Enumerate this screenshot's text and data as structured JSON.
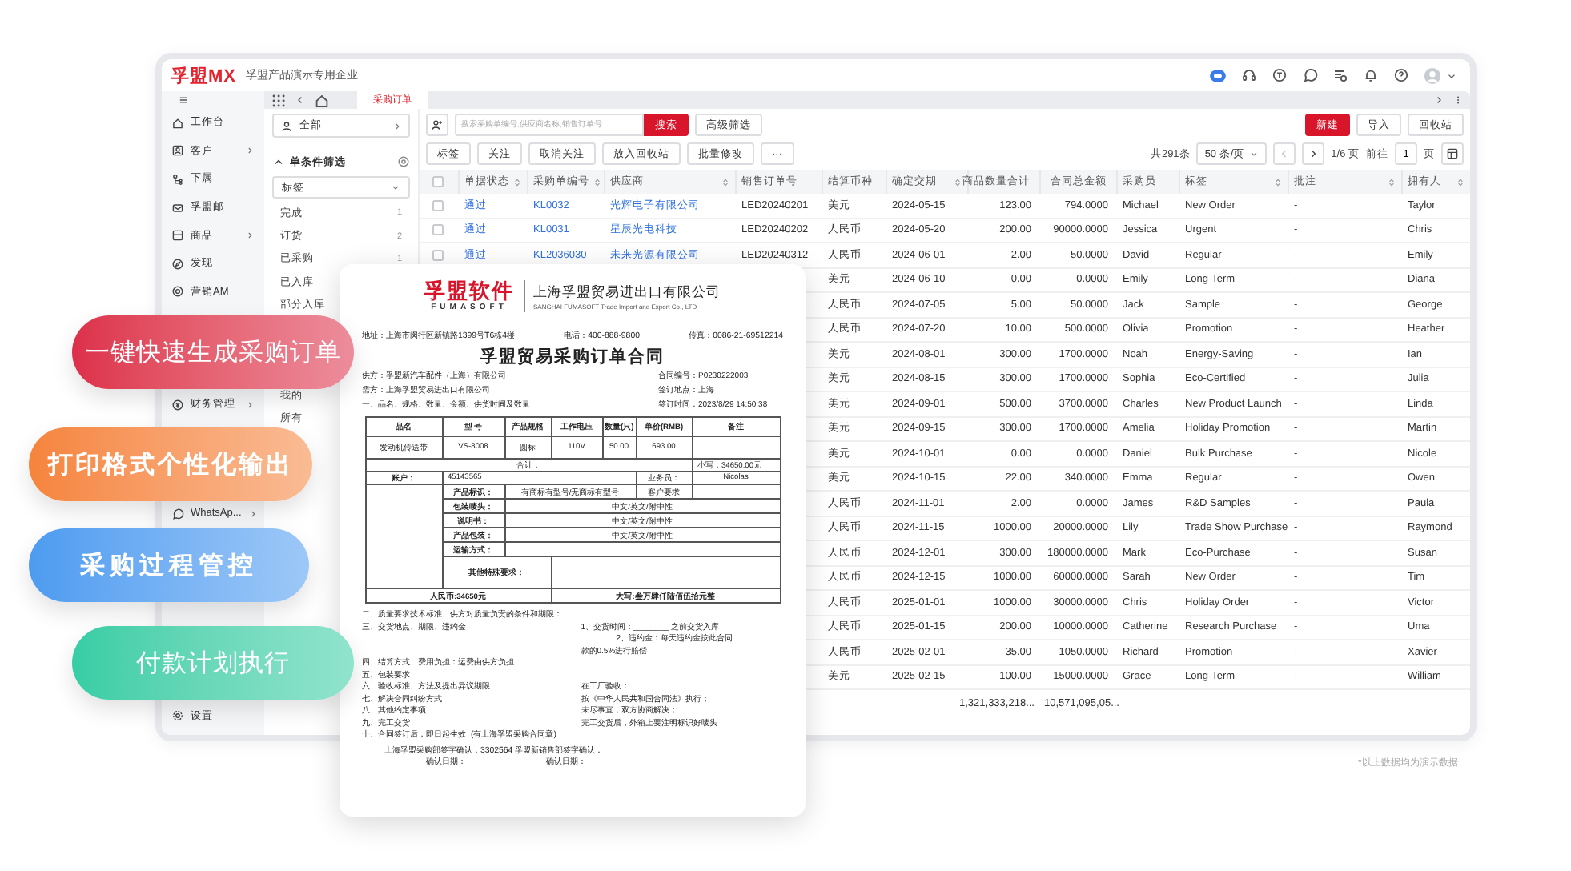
{
  "app": {
    "logo": "孚盟MX",
    "company": "孚盟产品演示专用企业"
  },
  "sidebar": {
    "items": [
      {
        "label": "工作台",
        "has_children": false
      },
      {
        "label": "客户",
        "has_children": true
      },
      {
        "label": "下属",
        "has_children": false
      },
      {
        "label": "孚盟邮",
        "has_children": false
      },
      {
        "label": "商品",
        "has_children": true
      },
      {
        "label": "发现",
        "has_children": false
      },
      {
        "label": "营销AM",
        "has_children": false
      },
      {
        "label": "财务管理",
        "has_children": true
      },
      {
        "label": "WhatsAp...",
        "has_children": true
      },
      {
        "label": "设置",
        "has_children": false
      }
    ]
  },
  "tabs": [
    {
      "label": "采购订单",
      "selected": true
    }
  ],
  "filter": {
    "scope": "全部",
    "section": "单条件筛选",
    "expanded": true,
    "field": "标签",
    "options": [
      {
        "label": "完成",
        "count": "1"
      },
      {
        "label": "订货",
        "count": "2"
      },
      {
        "label": "已采购",
        "count": "1"
      },
      {
        "label": "已入库"
      },
      {
        "label": "部分入库"
      },
      {
        "label": "我的"
      },
      {
        "label": "所有"
      }
    ]
  },
  "toolbar": {
    "search": {
      "placeholder": "搜索采购单编号,供应商名称,销售订单号"
    },
    "search_button": "搜索",
    "advanced": "高级筛选",
    "actions": [
      {
        "label": "新建",
        "primary": true
      },
      {
        "label": "导入",
        "primary": false
      },
      {
        "label": "回收站",
        "primary": false
      }
    ]
  },
  "bulk_actions": [
    "标签",
    "关注",
    "取消关注",
    "放入回收站",
    "批量修改",
    "···"
  ],
  "pagination": {
    "total": "共291条",
    "page_size": "50 条/页",
    "prev": {
      "disabled": true
    },
    "next": {
      "disabled": false
    },
    "page": "1/6 页",
    "goto": "前往",
    "goto_value": "1",
    "unit": "页"
  },
  "table": {
    "select_all": {
      "checked": false
    },
    "columns": [
      {
        "label": "单据状态",
        "sortable": true
      },
      {
        "label": "采购单编号",
        "sortable": true
      },
      {
        "label": "供应商",
        "sortable": true
      },
      {
        "label": "销售订单号",
        "sortable": false
      },
      {
        "label": "结算币种",
        "sortable": false
      },
      {
        "label": "确定交期",
        "sortable": true
      },
      {
        "label": "商品数量合计",
        "sortable": false
      },
      {
        "label": "合同总金额",
        "sortable": false
      },
      {
        "label": "采购员",
        "sortable": false
      },
      {
        "label": "标签",
        "sortable": true
      },
      {
        "label": "批注",
        "sortable": true
      },
      {
        "label": "拥有人",
        "sortable": true
      }
    ],
    "rows": [
      {
        "checked": false,
        "status": "通过",
        "code": "KL0032",
        "supplier": "光辉电子有限公司",
        "order": "LED20240201",
        "currency": "美元",
        "date": "2024-05-15",
        "qty": "123.00",
        "amount": "794.0000",
        "buyer": "Michael",
        "tag": "New Order",
        "note": "-",
        "owner": "Taylor"
      },
      {
        "checked": false,
        "status": "通过",
        "code": "KL0031",
        "supplier": "星辰光电科技",
        "order": "LED20240202",
        "currency": "人民币",
        "date": "2024-05-20",
        "qty": "200.00",
        "amount": "90000.0000",
        "buyer": "Jessica",
        "tag": "Urgent",
        "note": "-",
        "owner": "Chris"
      },
      {
        "checked": false,
        "status": "通过",
        "code": "KL2036030",
        "supplier": "未来光源有限公司",
        "order": "LED20240312",
        "currency": "人民币",
        "date": "2024-06-01",
        "qty": "2.00",
        "amount": "50.0000",
        "buyer": "David",
        "tag": "Regular",
        "note": "-",
        "owner": "Emily"
      },
      {
        "currency": "美元",
        "date": "2024-06-10",
        "qty": "0.00",
        "amount": "0.0000",
        "buyer": "Emily",
        "tag": "Long-Term",
        "note": "-",
        "owner": "Diana"
      },
      {
        "currency": "人民币",
        "date": "2024-07-05",
        "qty": "5.00",
        "amount": "50.0000",
        "buyer": "Jack",
        "tag": "Sample",
        "note": "-",
        "owner": "George"
      },
      {
        "currency": "人民币",
        "date": "2024-07-20",
        "qty": "10.00",
        "amount": "500.0000",
        "buyer": "Olivia",
        "tag": "Promotion",
        "note": "-",
        "owner": "Heather"
      },
      {
        "currency": "美元",
        "date": "2024-08-01",
        "qty": "300.00",
        "amount": "1700.0000",
        "buyer": "Noah",
        "tag": "Energy-Saving",
        "note": "-",
        "owner": "Ian"
      },
      {
        "currency": "美元",
        "date": "2024-08-15",
        "qty": "300.00",
        "amount": "1700.0000",
        "buyer": "Sophia",
        "tag": "Eco-Certified",
        "note": "-",
        "owner": "Julia"
      },
      {
        "currency": "美元",
        "date": "2024-09-01",
        "qty": "500.00",
        "amount": "3700.0000",
        "buyer": "Charles",
        "tag": "New Product Launch",
        "note": "-",
        "owner": "Linda"
      },
      {
        "currency": "美元",
        "date": "2024-09-15",
        "qty": "300.00",
        "amount": "1700.0000",
        "buyer": "Amelia",
        "tag": "Holiday Promotion",
        "note": "-",
        "owner": "Martin"
      },
      {
        "currency": "美元",
        "date": "2024-10-01",
        "qty": "0.00",
        "amount": "0.0000",
        "buyer": "Daniel",
        "tag": "Bulk Purchase",
        "note": "-",
        "owner": "Nicole"
      },
      {
        "currency": "美元",
        "date": "2024-10-15",
        "qty": "22.00",
        "amount": "340.0000",
        "buyer": "Emma",
        "tag": "Regular",
        "note": "-",
        "owner": "Owen"
      },
      {
        "currency": "人民币",
        "date": "2024-11-01",
        "qty": "2.00",
        "amount": "0.0000",
        "buyer": "James",
        "tag": "R&D Samples",
        "note": "-",
        "owner": "Paula"
      },
      {
        "currency": "人民币",
        "date": "2024-11-15",
        "qty": "1000.00",
        "amount": "20000.0000",
        "buyer": "Lily",
        "tag": "Trade Show Purchase",
        "note": "-",
        "owner": "Raymond"
      },
      {
        "currency": "人民币",
        "date": "2024-12-01",
        "qty": "300.00",
        "amount": "180000.0000",
        "buyer": "Mark",
        "tag": "Eco-Purchase",
        "note": "-",
        "owner": "Susan"
      },
      {
        "currency": "人民币",
        "date": "2024-12-15",
        "qty": "1000.00",
        "amount": "60000.0000",
        "buyer": "Sarah",
        "tag": "New Order",
        "note": "-",
        "owner": "Tim"
      },
      {
        "currency": "人民币",
        "date": "2025-01-01",
        "qty": "1000.00",
        "amount": "30000.0000",
        "buyer": "Chris",
        "tag": "Holiday Order",
        "note": "-",
        "owner": "Victor"
      },
      {
        "currency": "人民币",
        "date": "2025-01-15",
        "qty": "200.00",
        "amount": "10000.0000",
        "buyer": "Catherine",
        "tag": "Research Purchase",
        "note": "-",
        "owner": "Uma"
      },
      {
        "currency": "人民币",
        "date": "2025-02-01",
        "qty": "35.00",
        "amount": "1050.0000",
        "buyer": "Richard",
        "tag": "Promotion",
        "note": "-",
        "owner": "Xavier"
      },
      {
        "currency": "美元",
        "date": "2025-02-15",
        "qty": "100.00",
        "amount": "15000.0000",
        "buyer": "Grace",
        "tag": "Long-Term",
        "note": "-",
        "owner": "William"
      }
    ],
    "totals": {
      "qty": "1,321,333,218...",
      "amount": "10,571,095,05..."
    }
  },
  "document": {
    "brand": "孚盟软件",
    "brand_en": "FUMASOFT",
    "company": "上海孚盟贸易进出口有限公司",
    "company_en": "SANGHAI FUMASOFT Trade Import and Export Co., LTD",
    "address": "地址：上海市闵行区新镇路1399号T6栋4楼",
    "phone": "电话：400-888-9800",
    "fax": "传真：0086-21-69512214",
    "title": "孚盟贸易采购订单合同",
    "parties": [
      {
        "left": "供方：孚盟新汽车配件（上海）有限公司",
        "right": "合同编号：P0230222003"
      },
      {
        "left": "需方：上海孚盟贸易进出口有限公司",
        "right": "签订地点：上海"
      },
      {
        "left": "一、品名、规格、数量、金额、供货时间及数量",
        "right": "签订时间：2023/8/29 14:50:38"
      }
    ],
    "items": {
      "columns": [
        "品名",
        "型 号",
        "产品规格",
        "工作电压",
        "数量(只)",
        "单价(RMB)",
        "备注"
      ],
      "rows": [
        [
          "发动机传送带",
          "VS-8008",
          "圆标",
          "110V",
          "50.00",
          "693.00",
          ""
        ]
      ],
      "total_label": "合计：",
      "total_small": "小写：34650.00元",
      "account_label": "账户：",
      "account": "45143565",
      "sales_label": "业务员：",
      "sales": "Nicolas",
      "mark_label": "产品标识：",
      "mark": "有商标有型号/无商标有型号",
      "customer_req": "客户要求",
      "specs": [
        {
          "label": "包装唛头：",
          "value": "中文/英文/附中性"
        },
        {
          "label": "说明书：",
          "value": "中文/英文/附中性"
        },
        {
          "label": "产品包装：",
          "value": "中文/英文/附中性"
        },
        {
          "label": "运输方式："
        }
      ],
      "special_label": "其他特殊要求：",
      "rmb": "人民币:34650元",
      "capital": "大写:叁万肆仟陆佰伍拾元整"
    },
    "clauses": [
      {
        "text": "二、质量要求技术标准、供方对质量负责的条件和期限："
      },
      {
        "text": "三、交货地点、期限、违约金",
        "notes": [
          "1、交货时间：________ 之前交货入库",
          "2、违约金：每天违约金按此合同",
          "款的0.5%进行赔偿"
        ]
      },
      {
        "text": "四、结算方式、费用负担：运费由供方负担"
      },
      {
        "text": "五、包装要求"
      },
      {
        "text": "六、验收标准、方法及提出异议期限",
        "notes": [
          "在工厂验收："
        ]
      },
      {
        "text": "七、解决合同纠纷方式",
        "notes": [
          "按《中华人民共和国合同法》执行；"
        ]
      },
      {
        "text": "八、其他约定事项",
        "notes": [
          "未尽事宜，双方协商解决；"
        ]
      },
      {
        "text": "九、完工交货",
        "notes": [
          "完工交货后，外箱上要注明标识好唛头"
        ]
      },
      {
        "text": "十、合同签订后，即日起生效",
        "remark": "(有上海孚盟采购合同章)"
      }
    ],
    "signatures": "上海孚盟采购部签字确认：3302564 孚盟新销售部签字确认：",
    "dates": [
      "确认日期：",
      "确认日期："
    ]
  },
  "banners": [
    {
      "text": "一键快速生成采购订单",
      "color": "#dc2f4b"
    },
    {
      "text": "打印格式个性化输出",
      "color": "#f5843c"
    },
    {
      "text": "采购过程管控",
      "color": "#4d9bf0"
    },
    {
      "text": "付款计划执行",
      "color": "#36cda5"
    }
  ],
  "footnote": "*以上数据均为演示数据"
}
